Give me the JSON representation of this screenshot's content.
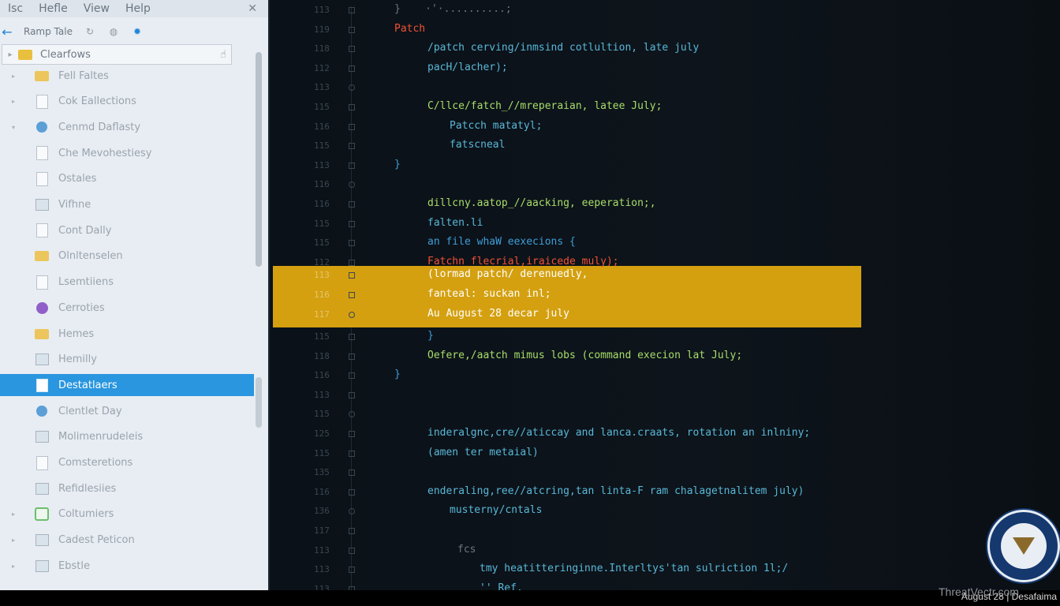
{
  "menu": [
    "Isc",
    "Hefle",
    "View",
    "Help"
  ],
  "close_glyph": "✕",
  "nav": {
    "title": "Ramp Tale"
  },
  "folder_box": {
    "label": "Clearfows"
  },
  "tree": [
    {
      "label": "Fell Faltes",
      "icon": "folder-icon",
      "twisty": "▸"
    },
    {
      "label": "Cok Eallections",
      "icon": "document-icon",
      "twisty": "▸"
    },
    {
      "label": "Cenmd Daflasty",
      "icon": "settings-icon",
      "twisty": "▾"
    },
    {
      "label": "Che Mevohestiesy",
      "icon": "document-icon",
      "twisty": ""
    },
    {
      "label": "Ostales",
      "icon": "document-icon",
      "twisty": ""
    },
    {
      "label": "Vifhne",
      "icon": "image-icon",
      "twisty": ""
    },
    {
      "label": "Cont Dally",
      "icon": "document-icon",
      "twisty": ""
    },
    {
      "label": "Olnltenselen",
      "icon": "folder-icon",
      "twisty": ""
    },
    {
      "label": "Lsemtiiens",
      "icon": "document-icon",
      "twisty": ""
    },
    {
      "label": "Cerroties",
      "icon": "circle-icon",
      "twisty": ""
    },
    {
      "label": "Hemes",
      "icon": "folder-icon",
      "twisty": ""
    },
    {
      "label": "Hemilly",
      "icon": "user-icon",
      "twisty": ""
    },
    {
      "label": "Destatlaers",
      "icon": "document-icon",
      "twisty": "",
      "selected": true
    },
    {
      "label": "Clentlet Day",
      "icon": "globe-icon",
      "twisty": ""
    },
    {
      "label": "Molimenrudeleis",
      "icon": "image-icon",
      "twisty": ""
    },
    {
      "label": "Comsteretions",
      "icon": "document-icon",
      "twisty": ""
    },
    {
      "label": "Refidlesiies",
      "icon": "image-icon",
      "twisty": ""
    },
    {
      "label": "Coltumiers",
      "icon": "green-icon",
      "twisty": "▸"
    },
    {
      "label": "Cadest Peticon",
      "icon": "image-icon",
      "twisty": "▸"
    },
    {
      "label": "Ebstle",
      "icon": "image-icon",
      "twisty": "▸"
    }
  ],
  "editor": {
    "lines": [
      {
        "ln": "113",
        "text": "}    ·'·..........;",
        "cls": "c-dim",
        "indent": 0
      },
      {
        "ln": "119",
        "text": "Patch",
        "cls": "c-red",
        "indent": 0
      },
      {
        "ln": "118",
        "text": "/patch cerving/inmsind cotlultion, late july",
        "cls": "c-cyan",
        "indent": 1
      },
      {
        "ln": "112",
        "text": "pacH/lacher);",
        "cls": "c-cyan",
        "indent": 1
      },
      {
        "ln": "113",
        "text": "",
        "cls": "c-dim",
        "indent": 1
      },
      {
        "ln": "115",
        "text": "C/llce/fatch_//mreperaian, latee July;",
        "cls": "c-green",
        "indent": 1
      },
      {
        "ln": "116",
        "text": "Patcch matatyl;",
        "cls": "c-cyan",
        "indent": 2
      },
      {
        "ln": "115",
        "text": "fatscneal",
        "cls": "c-cyan",
        "indent": 2
      },
      {
        "ln": "113",
        "text": "}",
        "cls": "c-blue",
        "indent": 0
      },
      {
        "ln": "116",
        "text": "",
        "cls": "c-dim",
        "indent": 0
      },
      {
        "ln": "116",
        "text": "dillcny.aatop_//aacking, eeperation;,",
        "cls": "c-green",
        "indent": 1
      },
      {
        "ln": "115",
        "text": "falten.li",
        "cls": "c-cyan",
        "indent": 1
      },
      {
        "ln": "115",
        "text": "an file whaW eexecions {",
        "cls": "c-blue",
        "indent": 1
      },
      {
        "ln": "112",
        "text": "Fatchn flecrial,iraicede muly);",
        "cls": "c-red",
        "indent": 1
      }
    ],
    "highlight_lines": [
      {
        "ln": "113",
        "text": "(lormad patch/ derenuedly,"
      },
      {
        "ln": "116",
        "text": "fanteal: suckan inl;"
      },
      {
        "ln": "117",
        "text": "Au August 28 decar july"
      }
    ],
    "lines_after": [
      {
        "ln": "115",
        "text": "}",
        "cls": "c-blue",
        "indent": 1
      },
      {
        "ln": "118",
        "text": "Oefere,/aatch mimus lobs (command execion lat July;",
        "cls": "c-green",
        "indent": 1
      },
      {
        "ln": "116",
        "text": "}",
        "cls": "c-blue",
        "indent": 0
      },
      {
        "ln": "113",
        "text": "",
        "cls": "c-dim",
        "indent": 0
      },
      {
        "ln": "115",
        "text": "",
        "cls": "c-dim",
        "indent": 0
      },
      {
        "ln": "125",
        "text": "inderalgnc,cre//aticcay and lanca.craats, rotation an inlniny;",
        "cls": "c-cyan",
        "indent": 1
      },
      {
        "ln": "115",
        "text": "(amen ter metaial)",
        "cls": "c-cyan",
        "indent": 1
      },
      {
        "ln": "135",
        "text": "",
        "cls": "c-dim",
        "indent": 1
      },
      {
        "ln": "116",
        "text": "enderaling,ree//atcring,tan linta-F ram chalagetnalitem july)",
        "cls": "c-cyan",
        "indent": 1
      },
      {
        "ln": "136",
        "text": "musterny/cntals",
        "cls": "c-cyan",
        "indent": 2
      },
      {
        "ln": "117",
        "text": "",
        "cls": "c-dim",
        "indent": 2
      },
      {
        "ln": "113",
        "text": "fcs",
        "cls": "c-dim",
        "indent": 3
      },
      {
        "ln": "113",
        "text": "tmy heatitteringinne.Interltys'tan sulriction 1l;/",
        "cls": "c-cyan",
        "indent": 4
      },
      {
        "ln": "113",
        "text": "'' Ref.",
        "cls": "c-cyan",
        "indent": 4
      }
    ]
  },
  "watermark": "ThreatVectr.com",
  "status_text": "August 28 | Desafaima",
  "colors": {
    "accent": "#2a96df",
    "highlight": "#d4a010",
    "sidebar_bg": "#e8edf3",
    "editor_bg": "#0c131a"
  }
}
